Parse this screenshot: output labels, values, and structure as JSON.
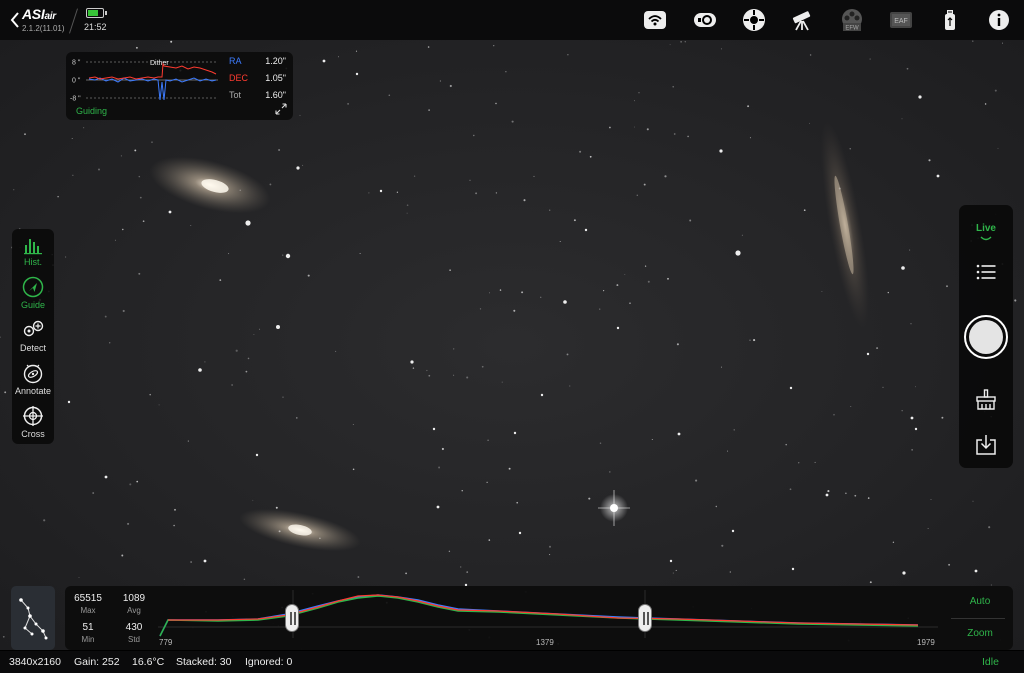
{
  "app": {
    "logo": "ASI",
    "logo_suffix": "air",
    "version": "2.1.2(11.01)",
    "clock": "21:52",
    "battery_level": 0.7
  },
  "topbar_icons": [
    "wifi-icon",
    "camera-icon",
    "mount-icon",
    "telescope-icon",
    "efw-icon",
    "eaf-icon",
    "usb-drive-icon",
    "info-icon"
  ],
  "topbar_labels": {
    "efw": "EFW",
    "eaf": "EAF"
  },
  "guide": {
    "y_top": "8 \"",
    "y_mid": "0 \"",
    "y_bottom": "-8 \"",
    "dither_label": "Dither",
    "ra_label": "RA",
    "ra_value": "1.20\"",
    "dec_label": "DEC",
    "dec_value": "1.05\"",
    "tot_label": "Tot",
    "tot_value": "1.60\"",
    "status": "Guiding",
    "colors": {
      "ra": "#3d7cff",
      "dec": "#ff3b30"
    }
  },
  "left_tools": [
    {
      "label": "Hist.",
      "icon": "histogram-icon",
      "active": true
    },
    {
      "label": "Guide",
      "icon": "guide-icon",
      "active": true
    },
    {
      "label": "Detect",
      "icon": "detect-icon",
      "active": false
    },
    {
      "label": "Annotate",
      "icon": "annotate-icon",
      "active": false
    },
    {
      "label": "Cross",
      "icon": "crosshair-icon",
      "active": false
    }
  ],
  "right_panel": {
    "live_label": "Live"
  },
  "histogram": {
    "max_value": "65515",
    "max_label": "Max",
    "avg_value": "1089",
    "avg_label": "Avg",
    "min_value": "51",
    "min_label": "Min",
    "std_value": "430",
    "std_label": "Std",
    "tick_left": "779",
    "tick_mid": "1379",
    "tick_right": "1979",
    "auto_label": "Auto",
    "zoom_label": "Zoom"
  },
  "status": {
    "resolution": "3840x2160",
    "gain": "Gain: 252",
    "temperature": "16.6°C",
    "stacked": "Stacked: 30",
    "ignored": "Ignored: 0",
    "state": "Idle"
  },
  "accent_color": "#2fb54a"
}
